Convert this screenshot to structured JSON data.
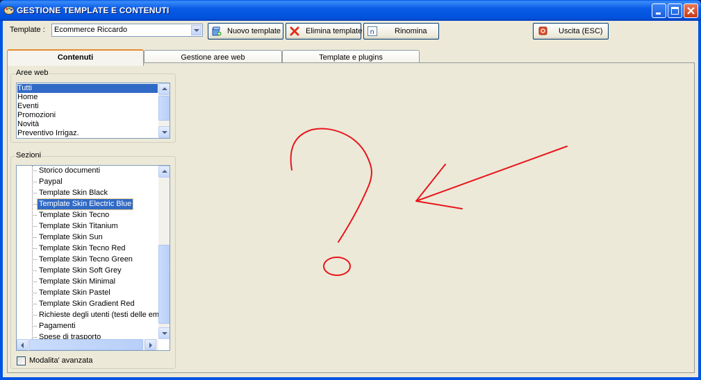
{
  "window": {
    "title": "GESTIONE TEMPLATE E CONTENUTI"
  },
  "toolbar": {
    "template_label": "Template :",
    "template_value": "Ecommerce Riccardo",
    "new_template": "Nuovo template",
    "delete_template": "Elimina template",
    "rename": "Rinomina",
    "exit": "Uscita (ESC)"
  },
  "tabs": [
    {
      "label": "Contenuti",
      "active": true
    },
    {
      "label": "Gestione aree web",
      "active": false
    },
    {
      "label": "Template e plugins",
      "active": false
    }
  ],
  "aree_web": {
    "title": "Aree web",
    "items": [
      "Tutti",
      "Home",
      "Eventi",
      "Promozioni",
      "Novità",
      "Preventivo Irrigaz."
    ],
    "selected_index": 0
  },
  "sezioni": {
    "title": "Sezioni",
    "items": [
      "Storico documenti",
      "Paypal",
      "Template Skin Black",
      "Template Skin Electric Blue",
      "Template Skin Tecno",
      "Template Skin Titanium",
      "Template Skin Sun",
      "Template Skin Tecno Red",
      "Template Skin Tecno Green",
      "Template Skin Soft Grey",
      "Template Skin Minimal",
      "Template Skin Pastel",
      "Template Skin Gradient Red",
      "Richieste degli utenti (testi delle ema",
      "Pagamenti",
      "Spese di trasporto"
    ],
    "selected_index": 3
  },
  "advanced_mode": {
    "label": "Modalita' avanzata",
    "checked": false
  },
  "annotation": {
    "color": "#e8141b",
    "shapes": [
      "question-mark",
      "arrow"
    ]
  }
}
